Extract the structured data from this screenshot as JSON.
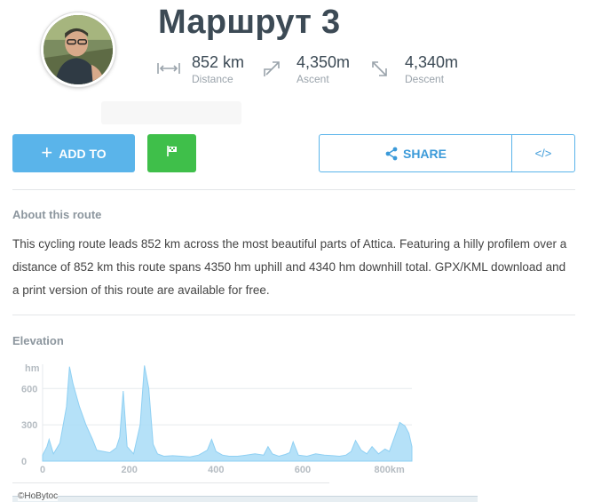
{
  "route": {
    "title": "Маршрут 3"
  },
  "stats": [
    {
      "icon": "distance-icon",
      "value": "852 km",
      "label": "Distance"
    },
    {
      "icon": "ascent-icon",
      "value": "4,350m",
      "label": "Ascent"
    },
    {
      "icon": "descent-icon",
      "value": "4,340m",
      "label": "Descent"
    }
  ],
  "actions": {
    "add_label": "ADD TO",
    "share_label": "SHARE",
    "embed_label": "</>"
  },
  "about": {
    "heading": "About this route",
    "text": "This cycling route leads 852 km across the most beautiful parts of Attica. Featuring a hilly profilem over a distance of 852 km this route spans 4350 hm uphill and 4340 hm downhill total. GPX/KML download and a print version of this route are available for free."
  },
  "elevation": {
    "heading": "Elevation",
    "unit_label": "hm",
    "y_ticks": [
      "600",
      "300",
      "0"
    ],
    "x_ticks": [
      "0",
      "200",
      "400",
      "600",
      "800km"
    ]
  },
  "map": {
    "label": "©HoBytoc"
  },
  "colors": {
    "accent": "#5ab4ea",
    "flag_green": "#3fbf4a",
    "title": "#3c4a55",
    "muted": "#9aa3ab"
  },
  "chart_data": {
    "type": "area",
    "x": [
      0,
      10,
      15,
      25,
      40,
      55,
      62,
      70,
      85,
      100,
      115,
      125,
      140,
      155,
      170,
      178,
      186,
      195,
      210,
      225,
      235,
      245,
      255,
      265,
      280,
      300,
      320,
      340,
      360,
      380,
      390,
      400,
      415,
      430,
      450,
      470,
      490,
      510,
      520,
      530,
      545,
      560,
      570,
      578,
      590,
      610,
      630,
      650,
      670,
      685,
      700,
      712,
      722,
      735,
      748,
      760,
      775,
      790,
      800,
      812,
      824,
      836,
      845,
      852
    ],
    "y": [
      50,
      120,
      180,
      60,
      150,
      450,
      780,
      640,
      450,
      300,
      180,
      90,
      80,
      70,
      110,
      200,
      580,
      120,
      60,
      300,
      790,
      600,
      140,
      60,
      40,
      45,
      40,
      35,
      50,
      90,
      180,
      80,
      50,
      40,
      40,
      50,
      60,
      50,
      120,
      60,
      40,
      55,
      70,
      160,
      50,
      40,
      60,
      50,
      45,
      40,
      50,
      80,
      170,
      90,
      60,
      120,
      60,
      100,
      80,
      200,
      320,
      290,
      230,
      120
    ],
    "ylabel": "hm",
    "xlabel": "",
    "xlim": [
      0,
      852
    ],
    "ylim": [
      0,
      800
    ],
    "x_tick_values": [
      0,
      200,
      400,
      600,
      800
    ],
    "y_tick_values": [
      0,
      300,
      600
    ],
    "grid": true,
    "fill_color": "#a8dcf7",
    "line_color": "#8fd0f3"
  }
}
